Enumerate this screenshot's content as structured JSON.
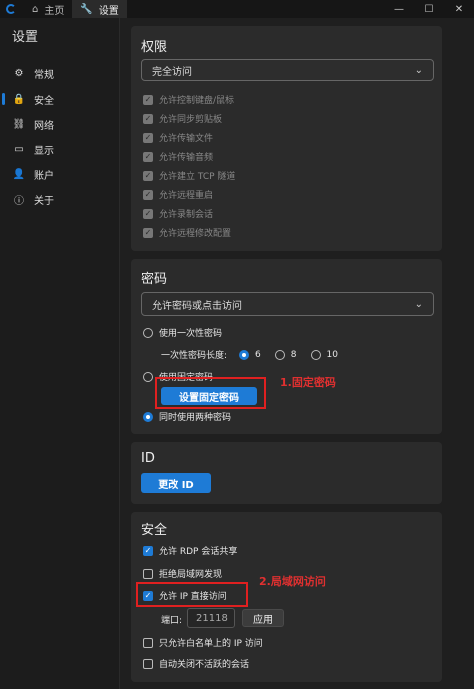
{
  "titlebar": {
    "tabs": [
      {
        "icon": "home-icon",
        "label": "主页"
      },
      {
        "icon": "wrench-icon",
        "label": "设置"
      }
    ]
  },
  "sidebar": {
    "title": "设置",
    "items": [
      {
        "icon": "gear-icon",
        "label": "常规"
      },
      {
        "icon": "lock-icon",
        "label": "安全"
      },
      {
        "icon": "link-icon",
        "label": "网络"
      },
      {
        "icon": "monitor-icon",
        "label": "显示"
      },
      {
        "icon": "user-icon",
        "label": "账户"
      },
      {
        "icon": "info-icon",
        "label": "关于"
      }
    ]
  },
  "permissions": {
    "title": "权限",
    "select_value": "完全访问",
    "checks": [
      "允许控制键盘/鼠标",
      "允许同步剪贴板",
      "允许传输文件",
      "允许传输音频",
      "允许建立 TCP 隧道",
      "允许远程重启",
      "允许录制会话",
      "允许远程修改配置"
    ]
  },
  "password": {
    "title": "密码",
    "select_value": "允许密码或点击访问",
    "radio_onetime": "使用一次性密码",
    "length_label": "一次性密码长度:",
    "lengths": [
      "6",
      "8",
      "10"
    ],
    "radio_fixed": "使用固定密码",
    "set_fixed_button": "设置固定密码",
    "radio_both": "同时使用两种密码"
  },
  "id_section": {
    "title": "ID",
    "change_button": "更改 ID"
  },
  "security": {
    "title": "安全",
    "rdp_share": "允许 RDP 会话共享",
    "deny_lan": "拒绝局域网发现",
    "direct_ip": "允许 IP 直接访问",
    "port_label": "端口:",
    "port_value": "21118",
    "apply_button": "应用",
    "whitelist": "只允许白名单上的 IP 访问",
    "auto_close": "自动关闭不活跃的会话"
  },
  "annotations": {
    "a1": "1.固定密码",
    "a2": "2.局域网访问"
  },
  "colors": {
    "accent": "#1e7bd6",
    "annotation": "#e02020"
  }
}
